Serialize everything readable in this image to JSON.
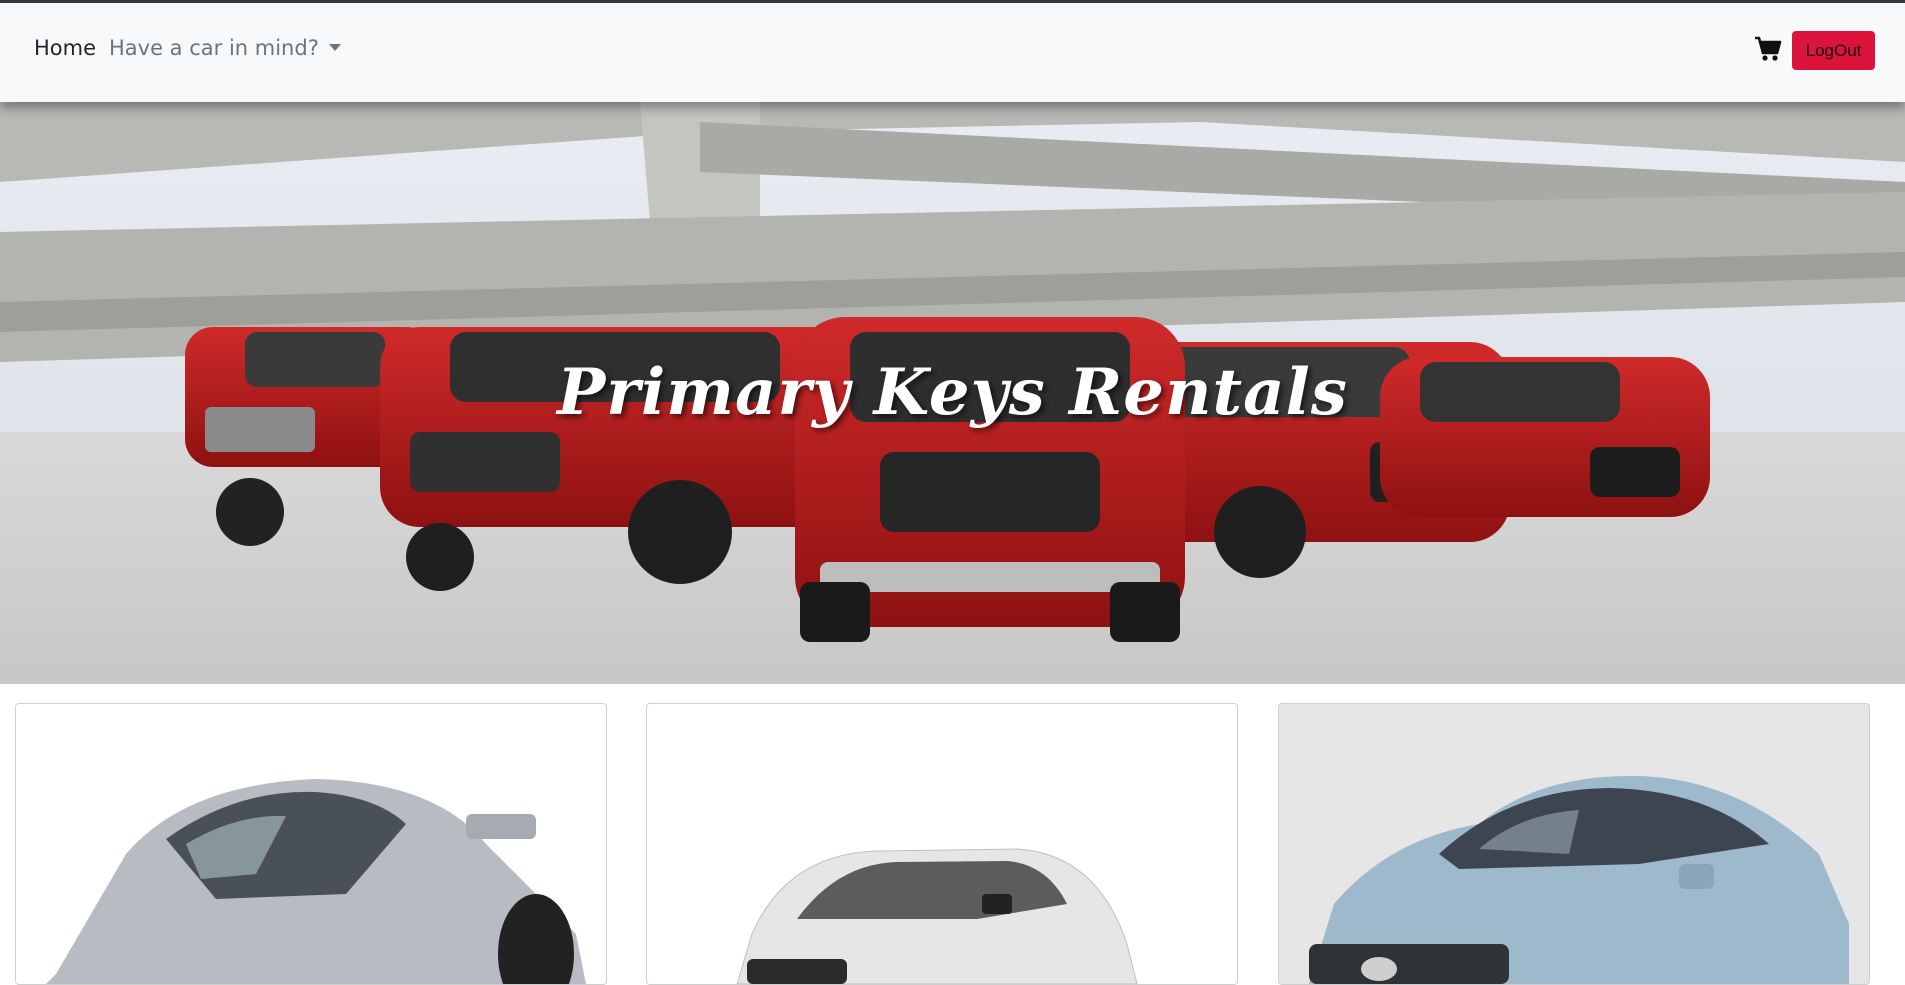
{
  "navbar": {
    "home_label": "Home",
    "dropdown_label": "Have a car in mind?",
    "cart_icon": "shopping-cart-icon",
    "logout_label": "LogOut",
    "logout_color": "#dc143c"
  },
  "hero": {
    "title": "Primary Keys Rentals"
  },
  "cards": [
    {
      "image": "silver sports car"
    },
    {
      "image": "white hatchback"
    },
    {
      "image": "light blue sedan"
    }
  ]
}
